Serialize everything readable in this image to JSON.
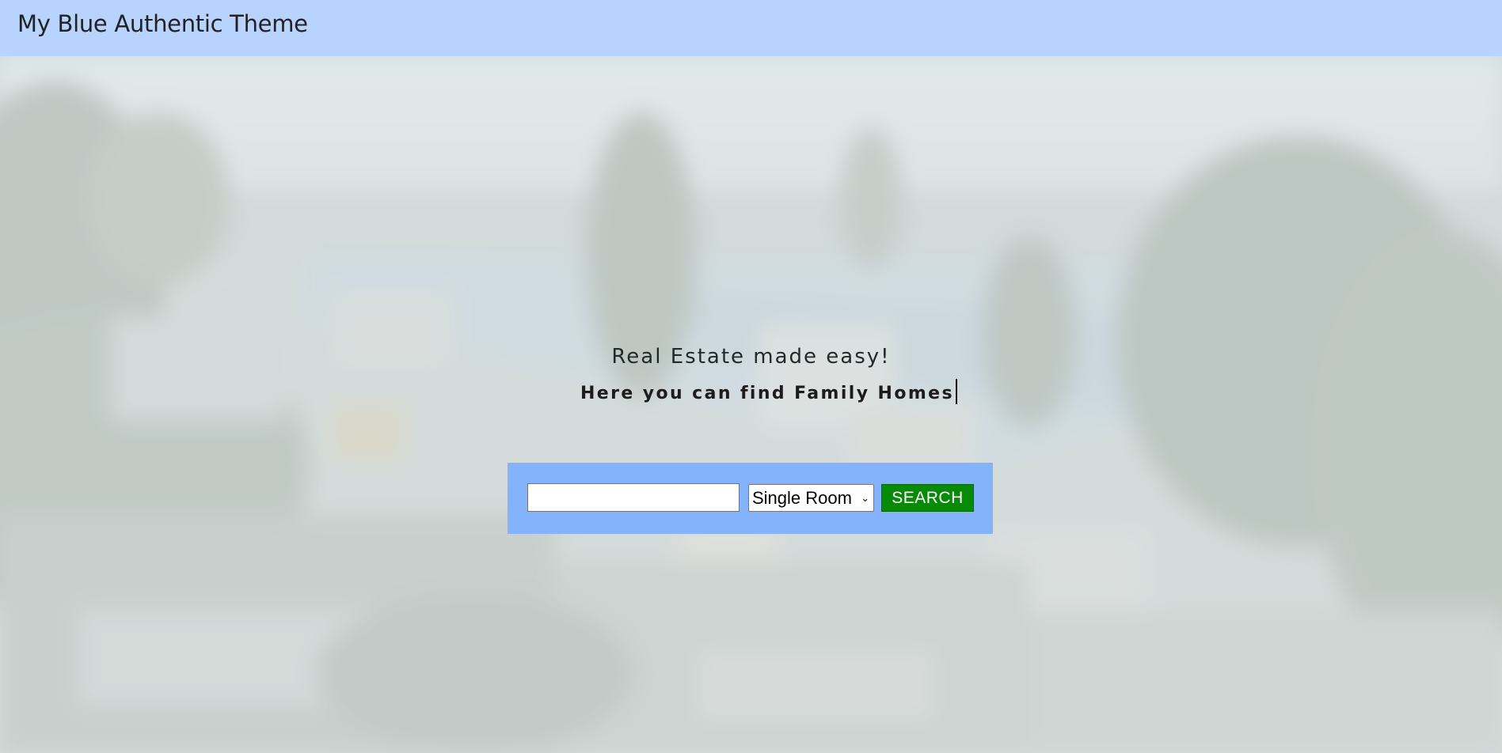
{
  "header": {
    "title": "My Blue Authentic Theme",
    "background": "#b8d4fe"
  },
  "hero": {
    "tagline": "Real Estate made easy!",
    "typed_text": "Here you can find Family Homes",
    "background_image": "blurred-lakeside-town-photo"
  },
  "search": {
    "input_value": "",
    "room_type_selected": "Single Room",
    "button_label": "SEARCH",
    "panel_color": "#84b2fb",
    "button_color": "#078a07"
  }
}
